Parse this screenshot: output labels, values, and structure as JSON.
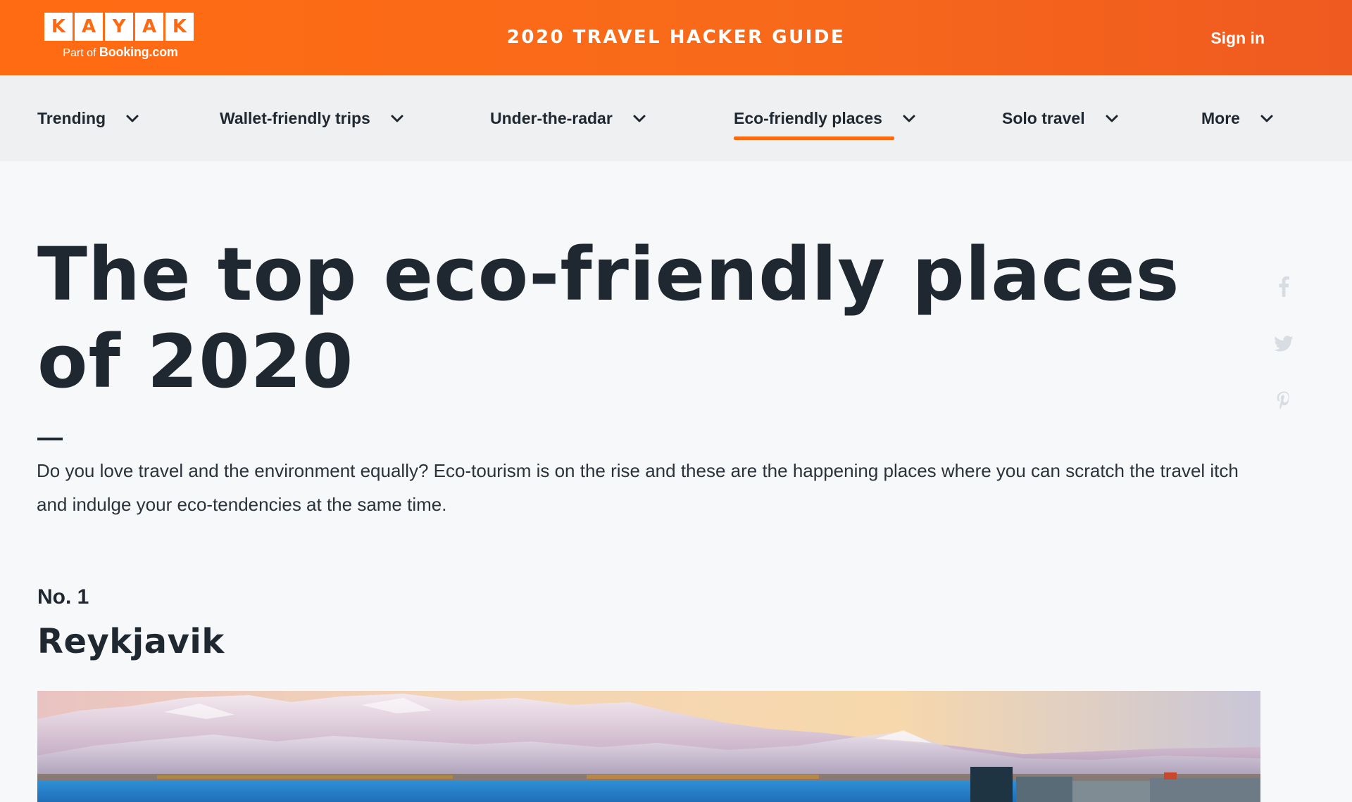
{
  "header": {
    "logo_letters": [
      "K",
      "A",
      "Y",
      "A",
      "K"
    ],
    "logo_sub_prefix": "Part of",
    "logo_sub_brand": "Booking.com",
    "guide_title": "2020 TRAVEL HACKER GUIDE",
    "sign_in": "Sign in",
    "brand_color": "#ff690f"
  },
  "nav": {
    "items": [
      {
        "label": "Trending"
      },
      {
        "label": "Wallet-friendly trips"
      },
      {
        "label": "Under-the-radar"
      },
      {
        "label": "Eco-friendly places",
        "active": true
      },
      {
        "label": "Solo travel"
      },
      {
        "label": "More"
      }
    ]
  },
  "article": {
    "headline": "The top eco-friendly places of 2020",
    "intro": "Do you love travel and the environment equally? Eco-tourism is on the rise and these are the happening places where you can scratch the travel itch and indulge your eco-tendencies at the same time.",
    "entry": {
      "rank": "No. 1",
      "place": "Reykjavik"
    }
  },
  "share": {
    "icons": [
      "facebook-icon",
      "twitter-icon",
      "pinterest-icon"
    ]
  }
}
